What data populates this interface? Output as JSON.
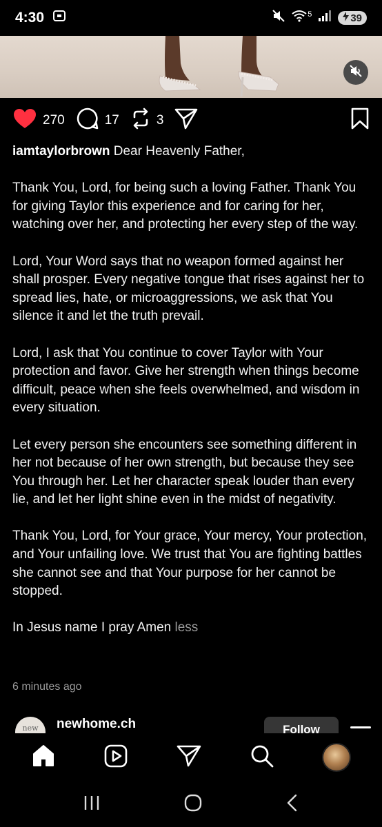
{
  "status_bar": {
    "time": "4:30",
    "battery_level": "39",
    "network": "5"
  },
  "post": {
    "likes": "270",
    "comments": "17",
    "reposts": "3",
    "username": "iamtaylorbrown",
    "caption_first_line": "Dear Heavenly Father,",
    "paragraphs": [
      "Thank You, Lord, for being such a loving Father. Thank You for giving Taylor this experience and for caring for her, watching over her, and protecting her every step of the way.",
      "Lord, Your Word says that no weapon formed against her shall prosper. Every negative tongue that rises against her to spread lies, hate, or microaggressions, we ask that You silence it and let the truth prevail.",
      "Lord, I ask that You continue to cover Taylor with Your protection and favor. Give her strength when things become difficult, peace when she feels overwhelmed, and wisdom in every situation.",
      "Let every person she encounters see something different in her not because of her own strength, but because they see You through her. Let her character speak louder than every lie, and let her light shine even in the midst of negativity.",
      "Thank You, Lord, for Your grace, Your mercy, Your protection, and Your unfailing love. We trust that You are fighting battles she cannot see and that Your purpose for her cannot be stopped."
    ],
    "closing": "In Jesus name I pray Amen",
    "less_label": "less",
    "timestamp": "6 minutes ago"
  },
  "next_post": {
    "avatar_text": "new",
    "username": "newhome.ch",
    "follow_label": "Follow"
  },
  "bottom_nav": [
    "home-icon",
    "reels-icon",
    "send-icon",
    "search-icon",
    "profile-avatar"
  ],
  "colors": {
    "background": "#000000",
    "like_red": "#ff3040",
    "muted_text": "#9a9a9a"
  }
}
